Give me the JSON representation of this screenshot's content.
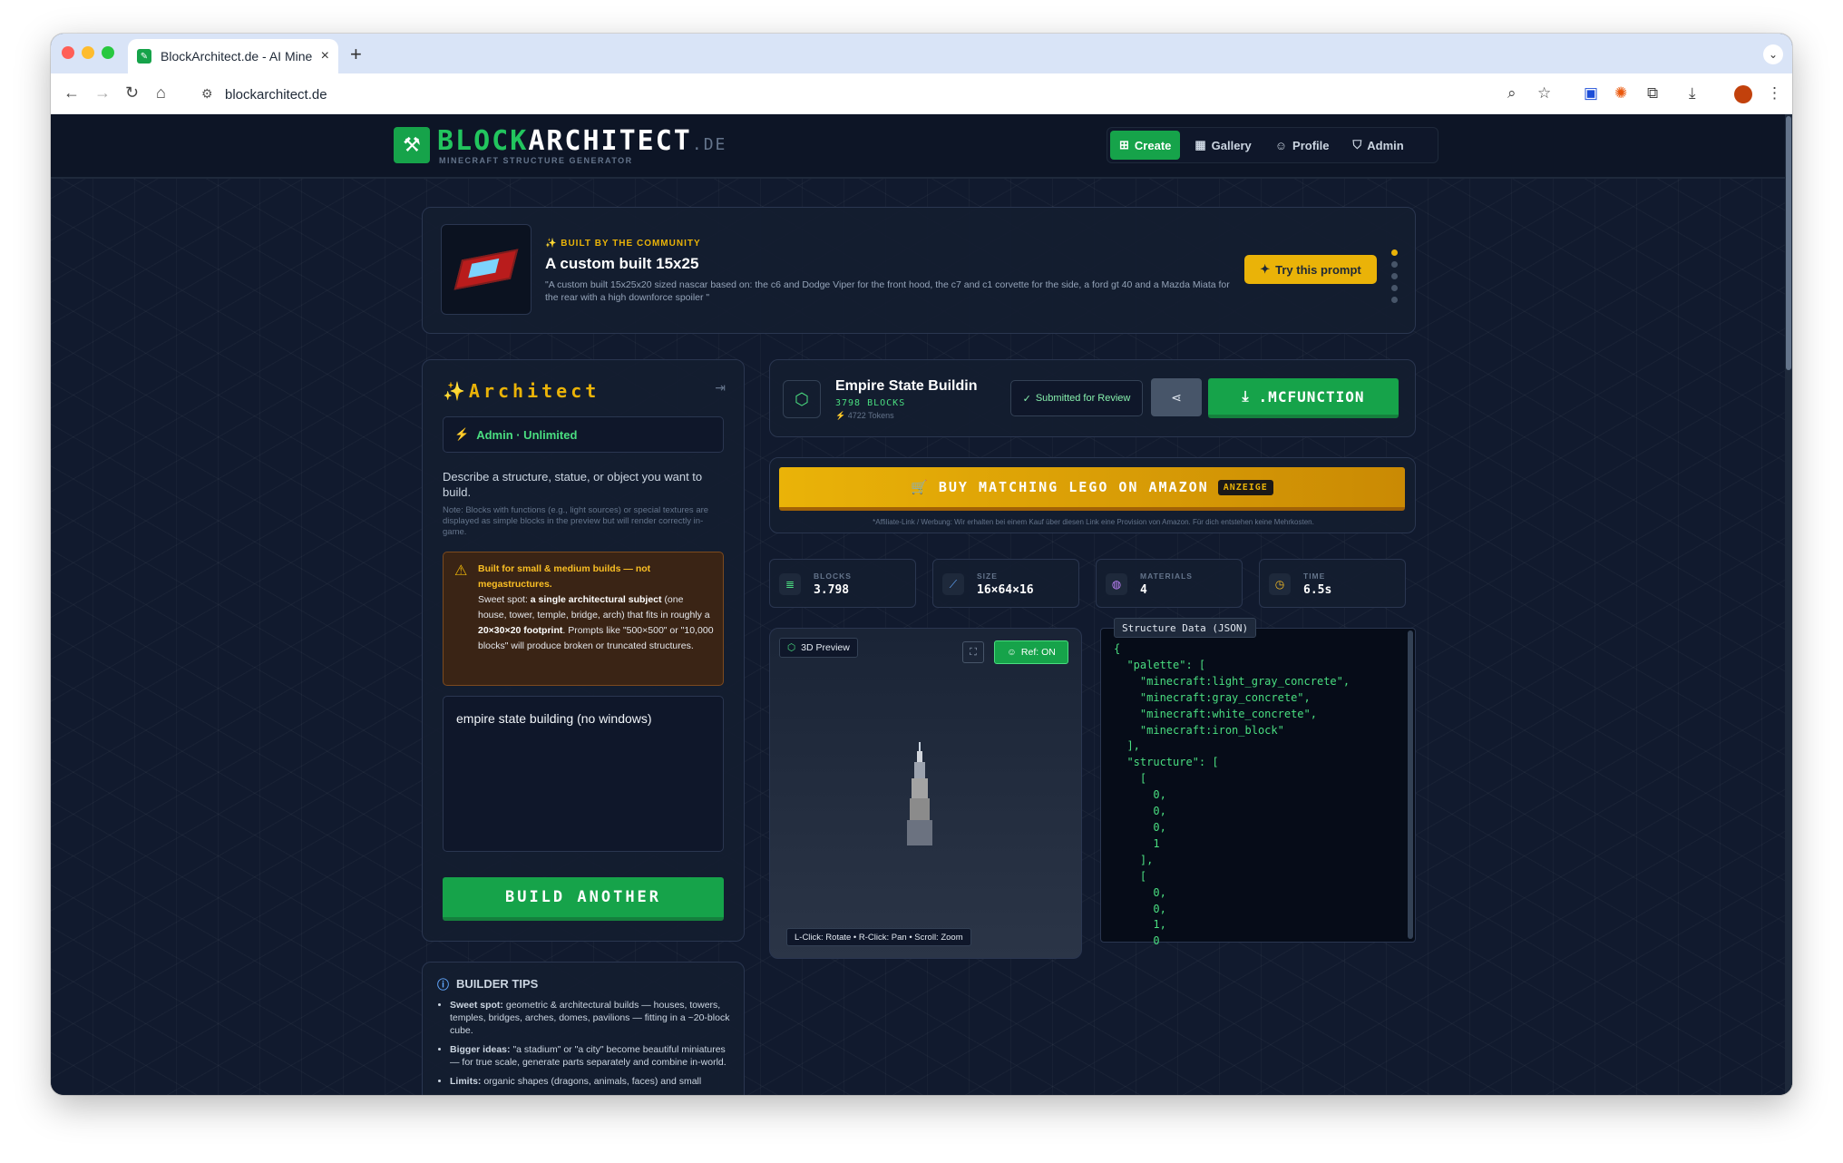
{
  "browser": {
    "tab_title": "BlockArchitect.de - AI Minecr",
    "url": "blockarchitect.de",
    "extension_badge": "1",
    "colors": {
      "red": "#ff5f57",
      "yellow": "#febc2e",
      "green": "#28c840"
    }
  },
  "header": {
    "brand_green": "BLOCK",
    "brand_white": "ARCHITECT",
    "brand_tld": ".DE",
    "subtitle": "MINECRAFT STRUCTURE GENERATOR",
    "nav": [
      {
        "label": "Create",
        "icon": "plus-square-icon",
        "active": true
      },
      {
        "label": "Gallery",
        "icon": "grid-icon"
      },
      {
        "label": "Profile",
        "icon": "user-icon"
      },
      {
        "label": "Admin",
        "icon": "shield-icon"
      }
    ]
  },
  "featured": {
    "eyebrow": "✨ BUILT BY THE COMMUNITY",
    "title": "A custom built 15x25",
    "description": "\"A custom built 15x25x20 sized nascar based on: the c6 and Dodge Viper for the front hood, the c7 and c1 corvette for the side, a ford gt 40 and a Mazda Miata for the rear with a high downforce spoiler \"",
    "button": "Try this prompt"
  },
  "architect": {
    "title": "Architect",
    "plan": "Admin · Unlimited",
    "description": "Describe a structure, statue, or object you want to build.",
    "note": "Note: Blocks with functions (e.g., light sources) or special textures are displayed as simple blocks in the preview but will render correctly in-game.",
    "warning_title": "Built for small & medium builds — not megastructures.",
    "warning_sweet_label": "Sweet spot:",
    "warning_subject": "a single architectural subject",
    "warning_examples": "(one house, tower, temple, bridge, arch) that fits in roughly a",
    "warning_footprint": "20×30×20 footprint",
    "warning_tail": ". Prompts like \"500×500\" or \"10,000 blocks\" will produce broken or truncated structures.",
    "prompt_value": "empire state building (no windows)",
    "build_button": "BUILD ANOTHER"
  },
  "tips": {
    "title": "BUILDER TIPS",
    "items": [
      {
        "label": "Sweet spot:",
        "text": "geometric & architectural builds — houses, towers, temples, bridges, arches, domes, pavilions — fitting in a ~20-block cube."
      },
      {
        "label": "Bigger ideas:",
        "text": "\"a stadium\" or \"a city\" become beautiful miniatures — for true scale, generate parts separately and combine in-world."
      },
      {
        "label": "Limits:",
        "text": "organic shapes (dragons, animals, faces) and small"
      }
    ]
  },
  "result": {
    "title": "Empire State Buildin",
    "blocks": "3798 BLOCKS",
    "tokens": "4722 Tokens",
    "review": "Submitted for Review",
    "download": ".MCFUNCTION"
  },
  "amazon": {
    "button": "BUY MATCHING LEGO ON AMAZON",
    "badge": "ANZEIGE",
    "disclaimer": "*Affiliate-Link / Werbung: Wir erhalten bei einem Kauf über diesen Link eine Provision von Amazon. Für dich entstehen keine Mehrkosten."
  },
  "stats": [
    {
      "label": "BLOCKS",
      "value": "3.798",
      "icon": "layers-icon",
      "color": "#4ade80"
    },
    {
      "label": "SIZE",
      "value": "16×64×16",
      "icon": "ruler-icon",
      "color": "#60a5fa"
    },
    {
      "label": "MATERIALS",
      "value": "4",
      "icon": "palette-icon",
      "color": "#c084fc"
    },
    {
      "label": "TIME",
      "value": "6.5s",
      "icon": "clock-icon",
      "color": "#fbbf24"
    }
  ],
  "preview": {
    "label": "3D Preview",
    "ref": "Ref: ON",
    "hint": "L-Click: Rotate • R-Click: Pan • Scroll: Zoom"
  },
  "json_panel": {
    "label": "Structure Data (JSON)",
    "content": "{\n  \"palette\": [\n    \"minecraft:light_gray_concrete\",\n    \"minecraft:gray_concrete\",\n    \"minecraft:white_concrete\",\n    \"minecraft:iron_block\"\n  ],\n  \"structure\": [\n    [\n      0,\n      0,\n      0,\n      1\n    ],\n    [\n      0,\n      0,\n      1,\n      0"
  }
}
